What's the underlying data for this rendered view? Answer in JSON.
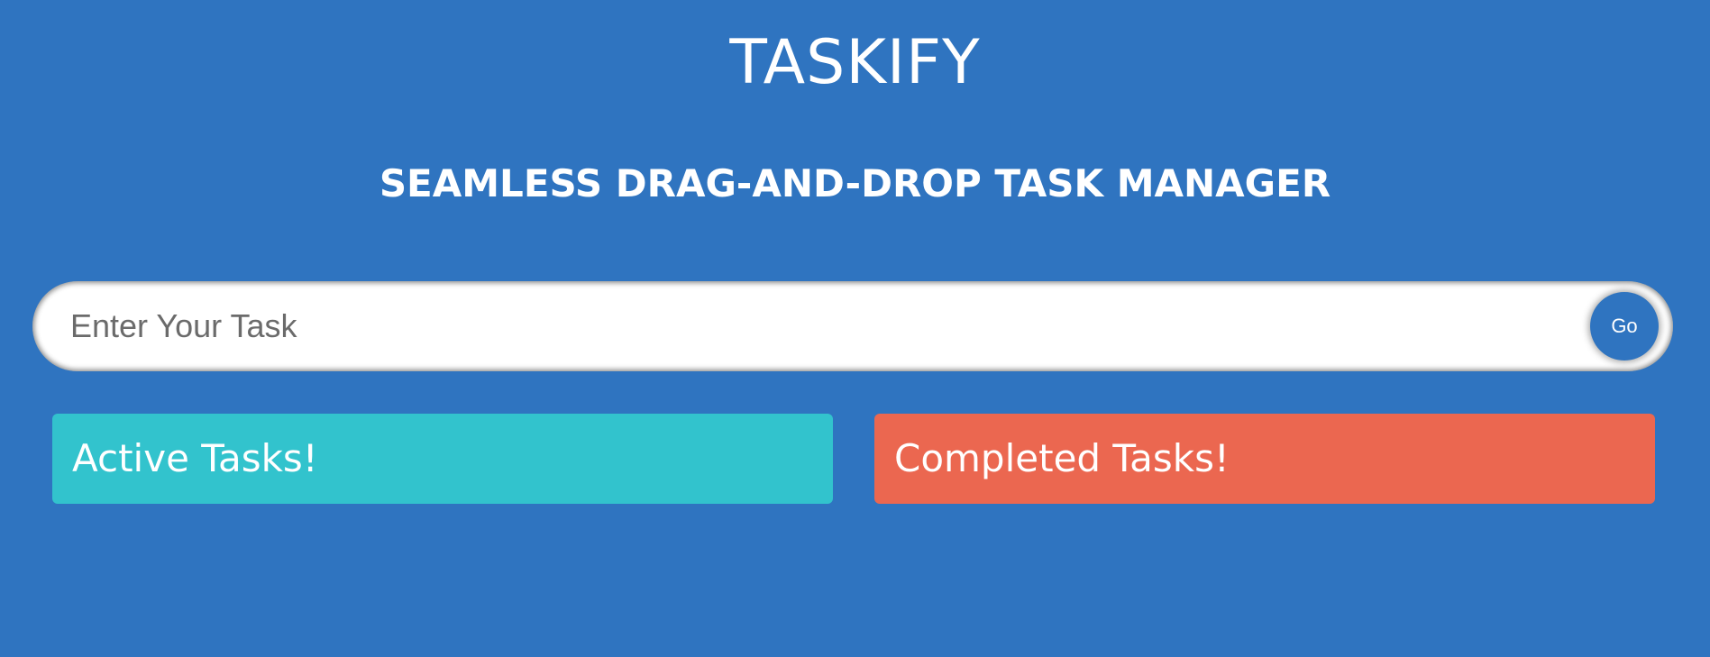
{
  "header": {
    "title": "TASKIFY",
    "subtitle": "SEAMLESS DRAG-AND-DROP TASK MANAGER"
  },
  "task_form": {
    "input_value": "",
    "input_placeholder": "Enter Your Task",
    "submit_label": "Go"
  },
  "columns": [
    {
      "heading": "Active Tasks!",
      "color": "#32c3cd",
      "tasks": []
    },
    {
      "heading": "Completed Tasks!",
      "color": "#eb6750",
      "tasks": []
    }
  ],
  "colors": {
    "background": "#2f74c0",
    "accent": "#2f74c0",
    "active": "#32c3cd",
    "completed": "#eb6750"
  }
}
